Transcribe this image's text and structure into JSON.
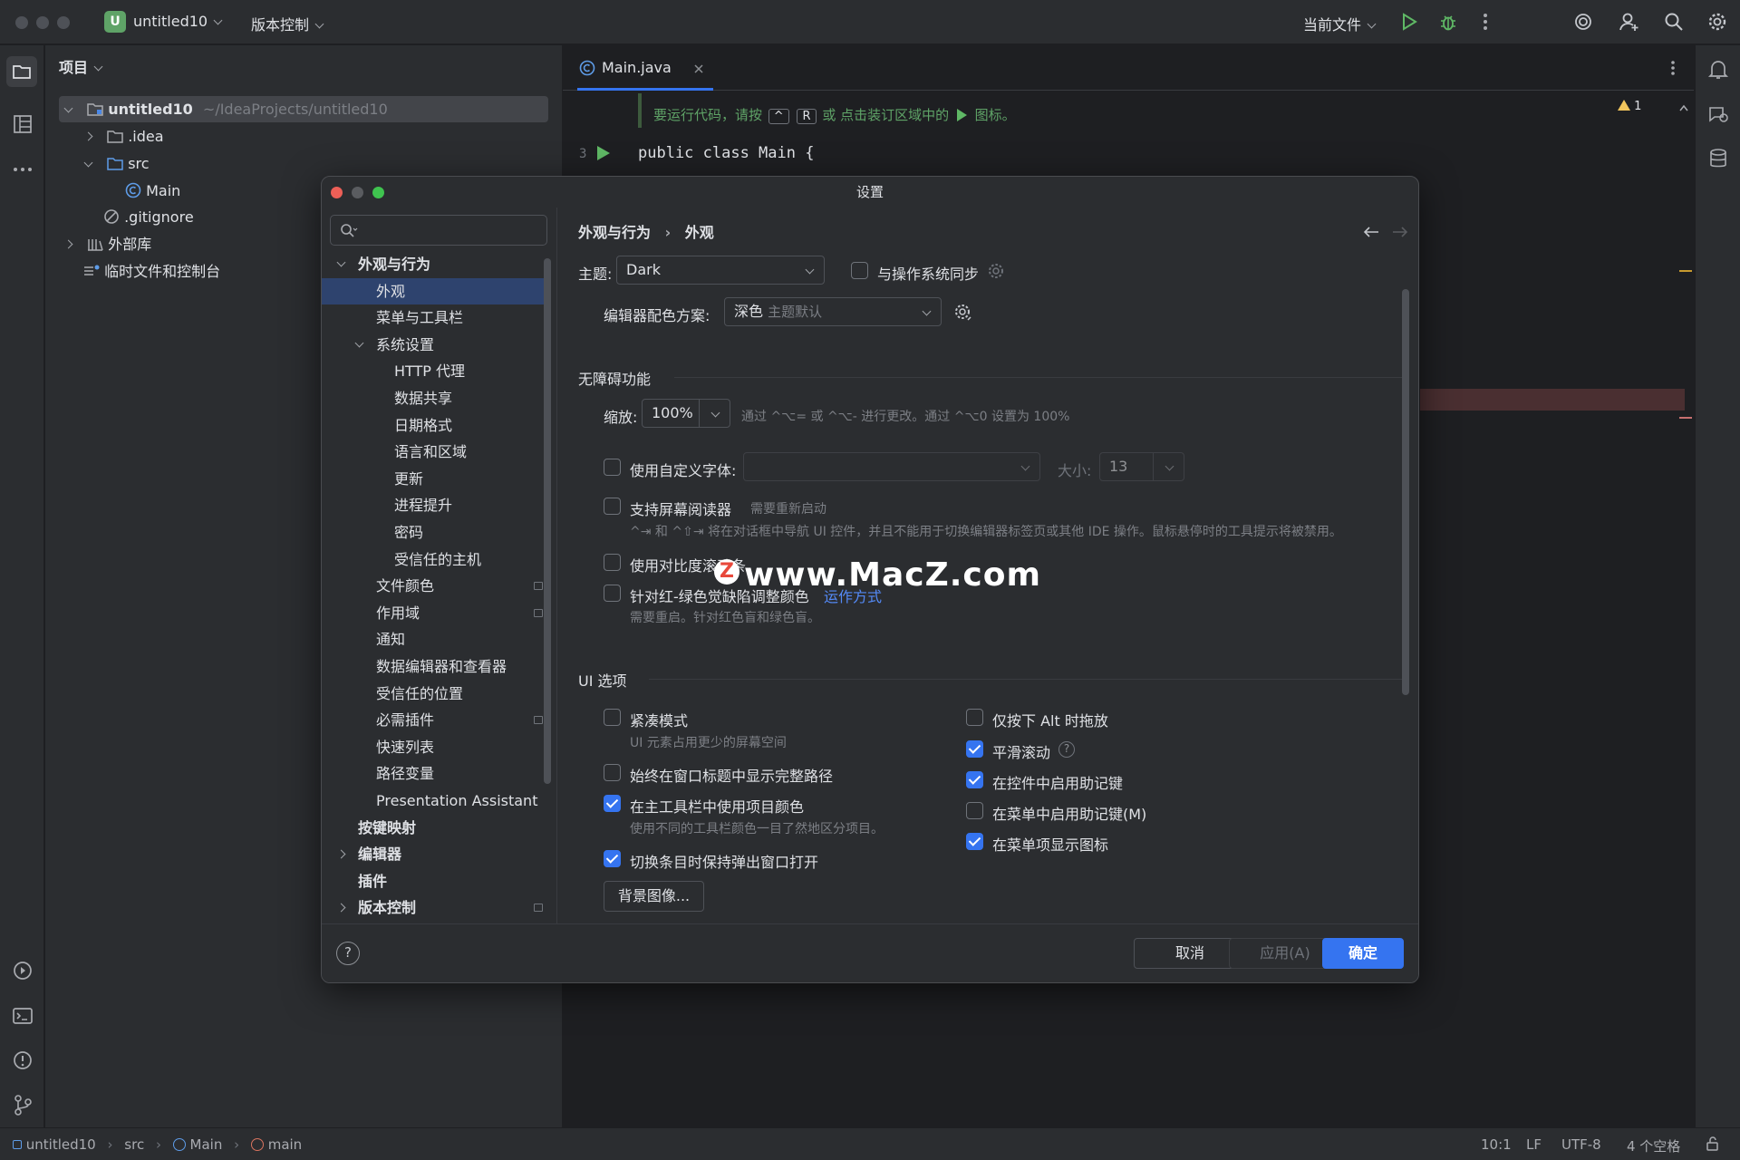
{
  "titlebar": {
    "project_badge": "U",
    "project_name": "untitled10",
    "vcs_menu": "版本控制",
    "run_config": "当前文件"
  },
  "project_panel": {
    "title": "项目",
    "root_name": "untitled10",
    "root_path": "~/IdeaProjects/untitled10",
    "items": [
      {
        "label": ".idea"
      },
      {
        "label": "src"
      },
      {
        "label": "Main"
      },
      {
        "label": ".gitignore"
      },
      {
        "label": "外部库"
      },
      {
        "label": "临时文件和控制台"
      }
    ]
  },
  "editor": {
    "tab_label": "Main.java",
    "hint_text_before": "要运行代码，请按",
    "hint_key1": "^",
    "hint_key2": "R",
    "hint_text_after": "或 点击装订区域中的",
    "hint_text_end": "图标。",
    "line_number": "3",
    "code_line": "public class Main {",
    "warning_count": "1"
  },
  "dialog": {
    "title": "设置",
    "search_placeholder": "",
    "breadcrumb_parent": "外观与行为",
    "breadcrumb_current": "外观",
    "nav": [
      {
        "label": "外观与行为"
      },
      {
        "label": "外观"
      },
      {
        "label": "菜单与工具栏"
      },
      {
        "label": "系统设置"
      },
      {
        "label": "HTTP 代理"
      },
      {
        "label": "数据共享"
      },
      {
        "label": "日期格式"
      },
      {
        "label": "语言和区域"
      },
      {
        "label": "更新"
      },
      {
        "label": "进程提升"
      },
      {
        "label": "密码"
      },
      {
        "label": "受信任的主机"
      },
      {
        "label": "文件颜色"
      },
      {
        "label": "作用域"
      },
      {
        "label": "通知"
      },
      {
        "label": "数据编辑器和查看器"
      },
      {
        "label": "受信任的位置"
      },
      {
        "label": "必需插件"
      },
      {
        "label": "快速列表"
      },
      {
        "label": "路径变量"
      },
      {
        "label": "Presentation Assistant"
      },
      {
        "label": "按键映射"
      },
      {
        "label": "编辑器"
      },
      {
        "label": "插件"
      },
      {
        "label": "版本控制"
      }
    ],
    "theme_label": "主题:",
    "theme_value": "Dark",
    "sync_os_label": "与操作系统同步",
    "scheme_label": "编辑器配色方案:",
    "scheme_value": "深色",
    "scheme_suffix": "主题默认",
    "accessibility_header": "无障碍功能",
    "zoom_label": "缩放:",
    "zoom_value": "100%",
    "zoom_hint": "通过 ^⌥= 或 ^⌥- 进行更改。通过 ^⌥0 设置为 100%",
    "custom_font_label": "使用自定义字体:",
    "size_label": "大小:",
    "size_value": "13",
    "screen_reader_label": "支持屏幕阅读器",
    "screen_reader_hint": "需要重新启动",
    "screen_reader_desc": "^⇥ 和 ^⇧⇥ 将在对话框中导航 UI 控件，并且不能用于切换编辑器标签页或其他 IDE 操作。鼠标悬停时的工具提示将被禁用。",
    "contrast_label": "使用对比度滚动条",
    "colorblind_label": "针对红-绿色觉缺陷调整颜色",
    "colorblind_link": "运作方式",
    "colorblind_hint": "需要重启。针对红色盲和绿色盲。",
    "watermark": "www.MacZ.com",
    "ui_header": "UI 选项",
    "compact_label": "紧凑模式",
    "compact_hint": "UI 元素占用更少的屏幕空间",
    "full_path_label": "始终在窗口标题中显示完整路径",
    "project_color_label": "在主工具栏中使用项目颜色",
    "project_color_hint": "使用不同的工具栏颜色一目了然地区分项目。",
    "keep_popup_label": "切换条目时保持弹出窗口打开",
    "bg_image_btn": "背景图像...",
    "alt_drag_label": "仅按下 Alt 时拖放",
    "smooth_scroll_label": "平滑滚动",
    "mnemonic_ctrl_label": "在控件中启用助记键",
    "mnemonic_menu_label": "在菜单中启用助记键(M)",
    "menu_icons_label": "在菜单项显示图标",
    "help_glyph": "?",
    "cancel_btn": "取消",
    "apply_btn": "应用(A)",
    "ok_btn": "确定",
    "checkbox_states": {
      "sync_os": false,
      "custom_font": false,
      "screen_reader": false,
      "contrast": false,
      "colorblind": false,
      "compact": false,
      "full_path": false,
      "project_color": true,
      "keep_popup": true,
      "alt_drag": false,
      "smooth_scroll": true,
      "mnemonic_ctrl": true,
      "mnemonic_menu": false,
      "menu_icons": true
    },
    "accent_color": "#3574f0",
    "selection_color": "#2e436e"
  },
  "statusbar": {
    "crumbs": [
      "untitled10",
      "src",
      "Main",
      "main"
    ],
    "position": "10:1",
    "line_ending": "LF",
    "encoding": "UTF-8",
    "indent": "4 个空格"
  }
}
